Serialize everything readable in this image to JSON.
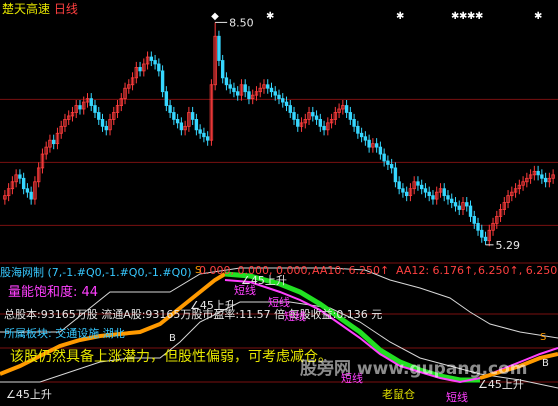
{
  "header": {
    "title": "楚天高速",
    "period": "日线"
  },
  "price_panel": {
    "high_label": "8.50",
    "low_label": "5.29",
    "ylim": [
      5.1,
      8.65
    ],
    "gridlines": [
      7.39,
      6.48,
      5.57
    ],
    "colors": {
      "up": "#ff3c3c",
      "down": "#37d7ff",
      "grid": "#7a1010"
    }
  },
  "indicator_bar": {
    "name": "股海网制 (7,-1.#Q0,-1.#Q0,-1.#Q0)",
    "values": "0.000, 0.000, 0.000,",
    "aa10": "AA10: 6.250↑",
    "aa12": "AA12: 6.176↑,",
    "tail": "6.250↑, 6.250"
  },
  "energy": {
    "label": "量能饱和度: 44"
  },
  "info": {
    "line1": "总股本:93165万股 流通A股:93165万股市盈率:11.57 倍 每股收益:0.136 元",
    "line2": "所属板块: 交通设施 湖北",
    "comment": "该股仍然具备上涨潜力，但股性偏弱，可考虑减仓。",
    "watermark": "股旁网 www.gupang.com"
  },
  "annotations": {
    "s_mark": "S",
    "b_mark": "B",
    "rise45_a": "∠45上升",
    "rise45_b": "∠45上升",
    "rise45_c": "∠45上升",
    "rise45_d": "∠45上升",
    "short_a": "短线",
    "short_b": "短线",
    "short_c": "短线",
    "short_d": "短线",
    "short_e": "短线",
    "mouse": "老鼠仓",
    "s_right": "S",
    "b_right": "B"
  },
  "chart_data": {
    "type": "candlestick",
    "title": "楚天高速 日线",
    "ylim": [
      5.1,
      8.65
    ],
    "high": 8.5,
    "low": 5.29,
    "close_series": [
      6.0,
      6.1,
      6.2,
      6.3,
      6.25,
      6.1,
      6.05,
      5.95,
      6.2,
      6.4,
      6.6,
      6.7,
      6.8,
      6.75,
      6.9,
      7.0,
      7.1,
      7.15,
      7.2,
      7.3,
      7.25,
      7.35,
      7.4,
      7.3,
      7.2,
      7.1,
      7.0,
      6.95,
      7.1,
      7.2,
      7.3,
      7.4,
      7.55,
      7.6,
      7.7,
      7.85,
      7.8,
      7.9,
      8.0,
      7.95,
      7.9,
      7.8,
      7.5,
      7.3,
      7.2,
      7.1,
      7.05,
      6.95,
      7.0,
      7.2,
      7.1,
      6.95,
      6.9,
      6.85,
      6.8,
      7.6,
      8.3,
      7.95,
      7.7,
      7.6,
      7.55,
      7.5,
      7.45,
      7.6,
      7.5,
      7.4,
      7.45,
      7.5,
      7.55,
      7.6,
      7.55,
      7.5,
      7.45,
      7.4,
      7.35,
      7.3,
      7.2,
      7.1,
      7.0,
      7.05,
      7.1,
      7.2,
      7.15,
      7.1,
      7.0,
      6.95,
      7.05,
      7.1,
      7.2,
      7.25,
      7.3,
      7.2,
      7.1,
      7.0,
      6.9,
      6.85,
      6.8,
      6.7,
      6.75,
      6.7,
      6.6,
      6.5,
      6.45,
      6.4,
      6.2,
      6.1,
      6.05,
      6.0,
      6.1,
      6.2,
      6.15,
      6.1,
      6.05,
      6.0,
      5.95,
      6.05,
      6.1,
      6.0,
      5.95,
      5.9,
      5.85,
      5.8,
      5.9,
      5.85,
      5.7,
      5.6,
      5.5,
      5.4,
      5.35,
      5.5,
      5.6,
      5.7,
      5.8,
      5.9,
      6.0,
      6.05,
      6.1,
      6.15,
      6.2,
      6.25,
      6.3,
      6.35,
      6.3,
      6.25,
      6.2,
      6.25,
      6.3
    ]
  }
}
